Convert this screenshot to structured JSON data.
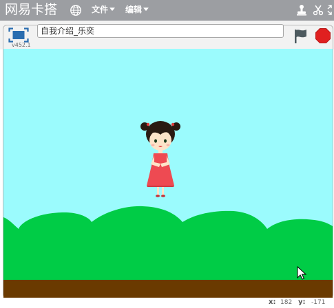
{
  "app": {
    "logo_text": "网易卡搭"
  },
  "menu": {
    "file_label": "文件",
    "edit_label": "编辑"
  },
  "stage_header": {
    "project_title": "自我介绍_乐奕",
    "version": "v452.1"
  },
  "stage": {
    "backdrop": "sky-with-green-hills",
    "sprite": "girl-in-red-dress"
  },
  "mouse": {
    "x_label": "x:",
    "x_value": "182",
    "y_label": "y:",
    "y_value": "-171"
  },
  "colors": {
    "menubar": "#9c9ea2",
    "sky": "#9bfbfd",
    "grass": "#00cc46",
    "ground": "#6a3a00",
    "stop": "#e02020",
    "present_button": "#2a6db0"
  }
}
